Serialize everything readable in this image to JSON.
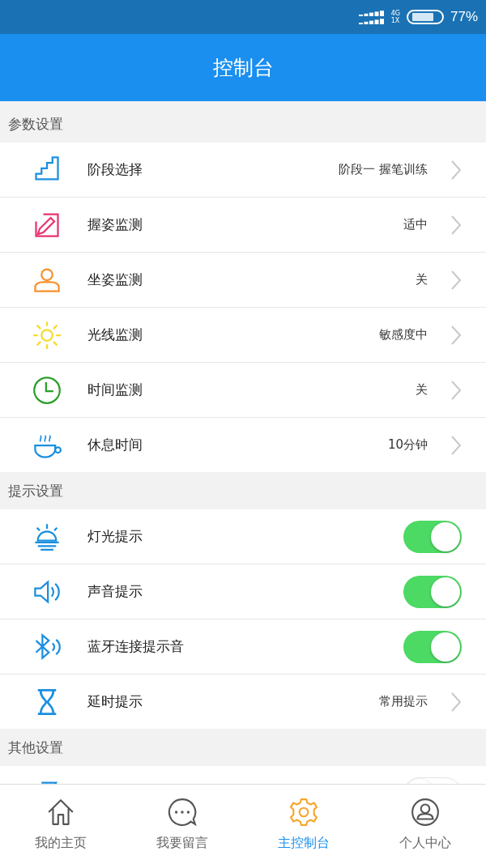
{
  "status_bar": {
    "network_top": "4G",
    "network_bottom": "1X",
    "battery": "77%"
  },
  "app_bar": {
    "title": "控制台"
  },
  "sections": [
    {
      "title": "参数设置",
      "rows": [
        {
          "kind": "link",
          "label": "阶段选择",
          "value": "阶段一 握笔训练"
        },
        {
          "kind": "link",
          "label": "握姿监测",
          "value": "适中"
        },
        {
          "kind": "link",
          "label": "坐姿监测",
          "value": "关"
        },
        {
          "kind": "link",
          "label": "光线监测",
          "value": "敏感度中"
        },
        {
          "kind": "link",
          "label": "时间监测",
          "value": "关"
        },
        {
          "kind": "link",
          "label": "休息时间",
          "value": "10分钟"
        }
      ]
    },
    {
      "title": "提示设置",
      "rows": [
        {
          "kind": "toggle",
          "label": "灯光提示",
          "on": true
        },
        {
          "kind": "toggle",
          "label": "声音提示",
          "on": true
        },
        {
          "kind": "toggle",
          "label": "蓝牙连接提示音",
          "on": true
        },
        {
          "kind": "link",
          "label": "延时提示",
          "value": "常用提示"
        }
      ]
    },
    {
      "title": "其他设置",
      "rows": [
        {
          "kind": "toggle",
          "on": false
        }
      ]
    }
  ],
  "bottom_nav": [
    {
      "label": "我的主页",
      "selected": false
    },
    {
      "label": "我要留言",
      "selected": false
    },
    {
      "label": "主控制台",
      "selected": true
    },
    {
      "label": "个人中心",
      "selected": false
    }
  ]
}
